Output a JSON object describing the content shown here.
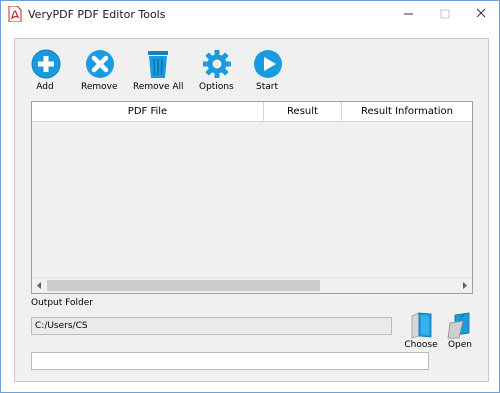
{
  "window": {
    "title": "VeryPDF PDF Editor Tools"
  },
  "toolbar": {
    "add_label": "Add",
    "remove_label": "Remove",
    "remove_all_label": "Remove All",
    "options_label": "Options",
    "start_label": "Start"
  },
  "table": {
    "columns": [
      "PDF File",
      "Result",
      "Result Information"
    ],
    "rows": []
  },
  "output": {
    "folder_label": "Output Folder",
    "folder_value": "C:/Users/CS",
    "choose_label": "Choose",
    "open_label": "Open"
  },
  "colors": {
    "accent_blue": "#1a9be0",
    "pdf_red": "#c8242b"
  }
}
